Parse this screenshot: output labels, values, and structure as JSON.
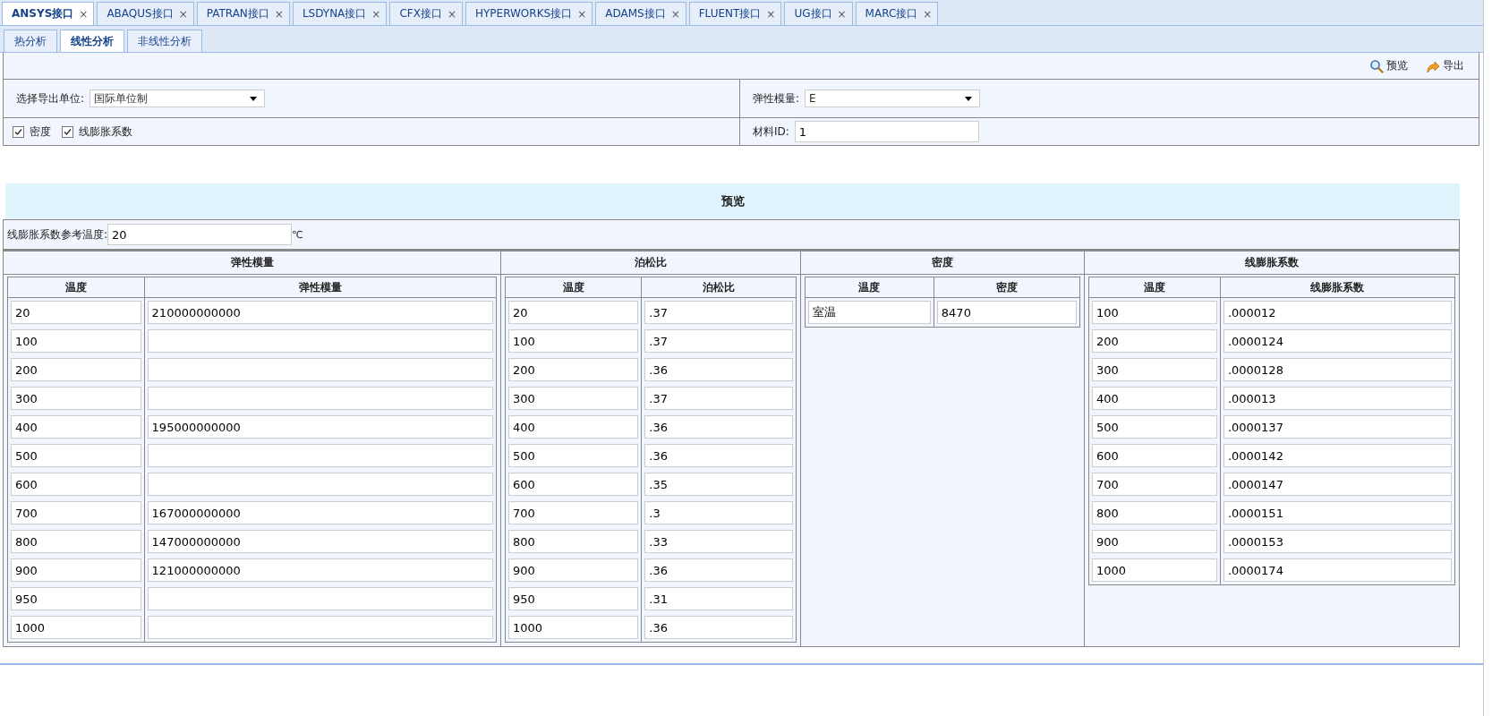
{
  "tabs": [
    {
      "label": "ANSYS接口",
      "selected": true
    },
    {
      "label": "ABAQUS接口",
      "selected": false
    },
    {
      "label": "PATRAN接口",
      "selected": false
    },
    {
      "label": "LSDYNA接口",
      "selected": false
    },
    {
      "label": "CFX接口",
      "selected": false
    },
    {
      "label": "HYPERWORKS接口",
      "selected": false
    },
    {
      "label": "ADAMS接口",
      "selected": false
    },
    {
      "label": "FLUENT接口",
      "selected": false
    },
    {
      "label": "UG接口",
      "selected": false
    },
    {
      "label": "MARC接口",
      "selected": false
    }
  ],
  "close_glyph": "×",
  "subtabs": [
    {
      "label": "热分析",
      "selected": false
    },
    {
      "label": "线性分析",
      "selected": true
    },
    {
      "label": "非线性分析",
      "selected": false
    }
  ],
  "toolbar": [
    {
      "kind": "preview",
      "label": "预览"
    },
    {
      "kind": "export",
      "label": "导出"
    }
  ],
  "unit_select": {
    "label": "选择导出单位:",
    "value": "国际单位制"
  },
  "modulus_select": {
    "label": "弹性模量:",
    "value": "E"
  },
  "checkboxes": [
    {
      "label": "密度",
      "checked": true
    },
    {
      "label": "线膨胀系数",
      "checked": true
    }
  ],
  "material_id": {
    "label": "材料ID:",
    "value": "1"
  },
  "preview_title": "预览",
  "reference_temperature": {
    "label": "线膨胀系数参考温度:",
    "value": "20",
    "unit": "℃"
  },
  "groups": [
    {
      "title": "弹性模量",
      "columns": [
        "温度",
        "弹性模量"
      ],
      "rows": [
        {
          "temp": "20",
          "value": "210000000000"
        },
        {
          "temp": "100"
        },
        {
          "temp": "200"
        },
        {
          "temp": "300"
        },
        {
          "temp": "400",
          "value": "195000000000"
        },
        {
          "temp": "500"
        },
        {
          "temp": "600"
        },
        {
          "temp": "700",
          "value": "167000000000"
        },
        {
          "temp": "800",
          "value": "147000000000"
        },
        {
          "temp": "900",
          "value": "121000000000"
        },
        {
          "temp": "950"
        },
        {
          "temp": "1000"
        }
      ]
    },
    {
      "title": "泊松比",
      "columns": [
        "温度",
        "泊松比"
      ],
      "rows": [
        {
          "temp": "20",
          "value": ".37"
        },
        {
          "temp": "100",
          "value": ".37"
        },
        {
          "temp": "200",
          "value": ".36"
        },
        {
          "temp": "300",
          "value": ".37"
        },
        {
          "temp": "400",
          "value": ".36"
        },
        {
          "temp": "500",
          "value": ".36"
        },
        {
          "temp": "600",
          "value": ".35"
        },
        {
          "temp": "700",
          "value": ".3"
        },
        {
          "temp": "800",
          "value": ".33"
        },
        {
          "temp": "900",
          "value": ".36"
        },
        {
          "temp": "950",
          "value": ".31"
        },
        {
          "temp": "1000",
          "value": ".36"
        }
      ]
    },
    {
      "title": "密度",
      "columns": [
        "温度",
        "密度"
      ],
      "rows": [
        {
          "temp": "室温",
          "value": "8470"
        }
      ]
    },
    {
      "title": "线膨胀系数",
      "columns": [
        "温度",
        "线膨胀系数"
      ],
      "rows": [
        {
          "temp": "100",
          "value": ".000012"
        },
        {
          "temp": "200",
          "value": ".0000124"
        },
        {
          "temp": "300",
          "value": ".0000128"
        },
        {
          "temp": "400",
          "value": ".000013"
        },
        {
          "temp": "500",
          "value": ".0000137"
        },
        {
          "temp": "600",
          "value": ".0000142"
        },
        {
          "temp": "700",
          "value": ".0000147"
        },
        {
          "temp": "800",
          "value": ".0000151"
        },
        {
          "temp": "900",
          "value": ".0000153"
        },
        {
          "temp": "1000",
          "value": ".0000174"
        }
      ]
    }
  ]
}
